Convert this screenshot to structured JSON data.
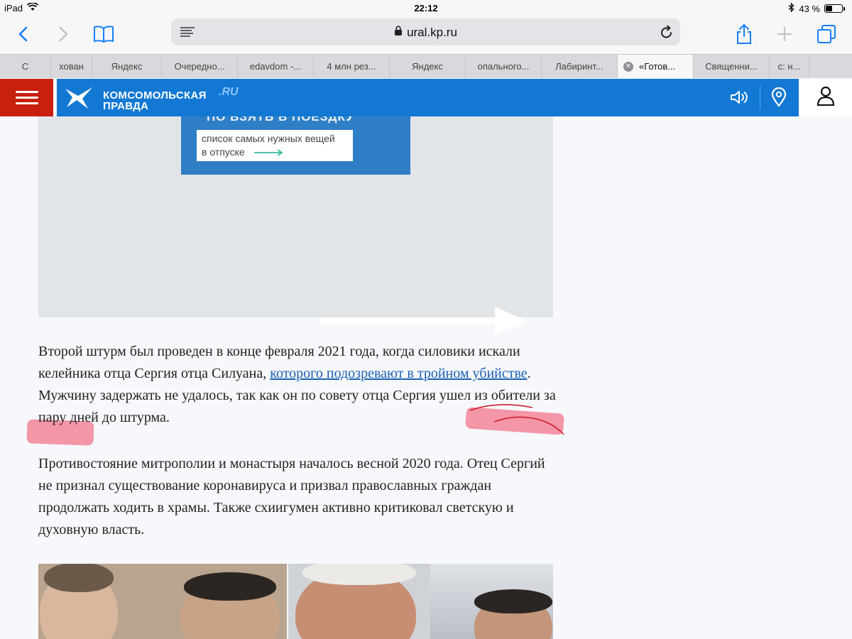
{
  "status_bar": {
    "device": "iPad",
    "time": "22:12",
    "battery_percent": "43 %",
    "battery_level": 0.43
  },
  "browser": {
    "url": "ural.kp.ru",
    "tabs": [
      {
        "label": "С"
      },
      {
        "label": "хован"
      },
      {
        "label": "Яндекс"
      },
      {
        "label": "Очередно..."
      },
      {
        "label": "edavdom -..."
      },
      {
        "label": "4 млн рез..."
      },
      {
        "label": "Яндекс"
      },
      {
        "label": "опального..."
      },
      {
        "label": "Лабиринт..."
      },
      {
        "label": "«Готов...",
        "active": true
      },
      {
        "label": "Священни..."
      },
      {
        "label": "с: н..."
      }
    ]
  },
  "site": {
    "logo_line1": "КОМСОМОЛЬСКАЯ",
    "logo_line2": "ПРАВДА",
    "logo_suffix": ".RU",
    "brand_blue": "#1278d4",
    "brand_red": "#c8200e"
  },
  "ad": {
    "headline": "ПО ВЗЯТЬ В ПОЕЗДКУ",
    "line1": "список самых нужных вещей",
    "line2": "в отпуске"
  },
  "article": {
    "p1_before_link": "Второй штурм был проведен в конце февраля 2021 года, когда силовики искали келейника отца Сергия отца Силуана, ",
    "p1_link": "которого подозревают в тройном убийстве",
    "p1_after_link": ". Мужчину задержать не удалось, так как он по совету отца Сергия ушел из обители за пару дней до штурма.",
    "p2": "Противостояние митрополии и монастыря началось весной 2020 года. Отец Сергий не признал существование коронавируса и призвал православных граждан продолжать ходить в храмы. Также схиигумен активно критиковал светскую и духовную власть."
  }
}
